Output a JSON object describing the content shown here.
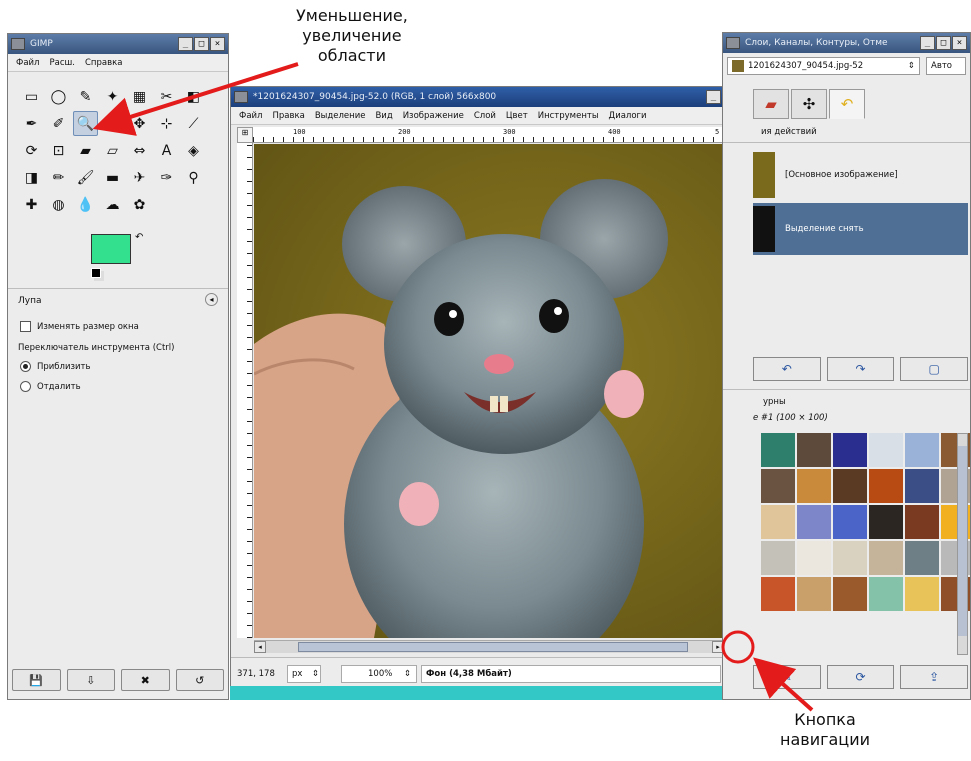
{
  "toolbox": {
    "title": "GIMP",
    "menu": [
      "Файл",
      "Расш.",
      "Справка"
    ],
    "tool_icons": [
      "rect-select-icon",
      "ellipse-select-icon",
      "lasso-icon",
      "fuzzy-select-icon",
      "color-select-icon",
      "scissors-icon",
      "foreground-select-icon",
      "paths-icon",
      "color-picker-icon",
      "zoom-icon",
      "measure-icon",
      "move-icon",
      "align-icon",
      "crop-icon",
      "rotate-icon",
      "scale-icon",
      "shear-icon",
      "perspective-icon",
      "flip-icon",
      "text-icon",
      "bucket-fill-icon",
      "blend-icon",
      "pencil-icon",
      "paintbrush-icon",
      "eraser-icon",
      "airbrush-icon",
      "ink-icon",
      "clone-icon",
      "heal-icon",
      "perspective-clone-icon",
      "blur-icon",
      "smudge-icon",
      "dodge-burn-icon"
    ],
    "tool_glyphs": [
      "▭",
      "◯",
      "✎",
      "✦",
      "▦",
      "✂",
      "◧",
      "✒",
      "✐",
      "🔍",
      "⚗",
      "✥",
      "⊹",
      "⟋",
      "⟳",
      "⊡",
      "▰",
      "▱",
      "⇔",
      "A",
      "◈",
      "◨",
      "✏",
      "🖌",
      "▬",
      "✈",
      "✑",
      "⚲",
      "✚",
      "◍",
      "💧",
      "☁",
      "✿"
    ],
    "fg_color": "#33e08d",
    "bg_color": "#ffffff",
    "tool_options": {
      "title": "Лупа",
      "resize_window": "Изменять размер окна",
      "switch_label": "Переключатель инструмента  (Ctrl)",
      "zoom_in": "Приблизить",
      "zoom_out": "Отдалить"
    }
  },
  "image_window": {
    "title": "*1201624307_90454.jpg-52.0 (RGB, 1 слой) 566x800",
    "menu": [
      "Файл",
      "Правка",
      "Выделение",
      "Вид",
      "Изображение",
      "Слой",
      "Цвет",
      "Инструменты",
      "Диалоги"
    ],
    "ruler_labels": [
      "100",
      "200",
      "300",
      "400",
      "5"
    ],
    "status": {
      "coords": "371, 178",
      "unit": "px",
      "zoom": "100%",
      "info": "Фон (4,38 Мбайт)"
    }
  },
  "dock": {
    "title": "Слои, Каналы, Контуры, Отме",
    "image_combo": "1201624307_90454.jpg-52",
    "auto_button": "Авто",
    "undo_header": "ия действий",
    "history": [
      "[Основное изображение]",
      "Выделение снять"
    ],
    "patterns_title": "урны",
    "patterns_sub": "е #1 (100 × 100)",
    "pattern_colors": [
      "#2e7f6b",
      "#5d4a3a",
      "#2a2f8f",
      "#d8dfe6",
      "#9ab2d8",
      "#8a5a32",
      "#6b5342",
      "#c98a3c",
      "#5a3a22",
      "#b84a14",
      "#3b4e86",
      "#b0a394",
      "#e0c49a",
      "#7d86c9",
      "#4a64c8",
      "#2c2622",
      "#7a3a22",
      "#f0b020",
      "#c4c1b8",
      "#ece7de",
      "#d9d2c0",
      "#c6b49a",
      "#6f7f86",
      "#b9b9b9",
      "#c8542a",
      "#caa06a",
      "#9b5a2c",
      "#84c2a9",
      "#e7c35a",
      "#8f4f28"
    ]
  },
  "annotations": {
    "top": [
      "Уменьшение,",
      "увеличение",
      "области"
    ],
    "bottom": [
      "Кнопка",
      "навигации"
    ]
  },
  "colors": {
    "arrow": "#e31b1b",
    "selection": "#4f6f95",
    "teal_strip": "#33c7c5"
  }
}
